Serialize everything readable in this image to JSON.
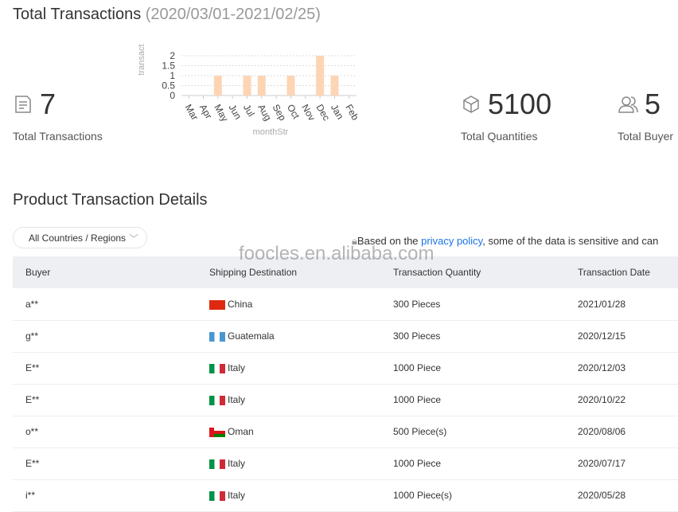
{
  "header": {
    "title": "Total Transactions",
    "date_range": "(2020/03/01-2021/02/25)"
  },
  "stats": [
    {
      "icon": "document-icon",
      "value": "7",
      "label": "Total Transactions"
    },
    {
      "icon": "box-icon",
      "value": "5100",
      "label": "Total Quantities"
    },
    {
      "icon": "users-icon",
      "value": "5",
      "label": "Total Buyer"
    }
  ],
  "chart_data": {
    "type": "bar",
    "categories": [
      "Mar",
      "Apr",
      "May",
      "Jun",
      "Jul",
      "Aug",
      "Sep",
      "Oct",
      "Nov",
      "Dec",
      "Jan",
      "Feb"
    ],
    "values": [
      0,
      0,
      1,
      0,
      1,
      1,
      0,
      1,
      0,
      2,
      1,
      0
    ],
    "xlabel": "monthStr",
    "ylabel": "transact",
    "ylim": [
      0,
      2
    ],
    "yticks": [
      "0",
      "0.5",
      "1",
      "1.5",
      "2"
    ],
    "grid": true,
    "color": "#fdd5b5"
  },
  "section": {
    "title": "Product Transaction Details"
  },
  "filter": {
    "label": "All Countries / Regions"
  },
  "notice": {
    "before": "Based on the ",
    "link": "privacy policy",
    "after": ", some of the data is sensitive and can"
  },
  "watermark": "foocles.en.alibaba.com",
  "table": {
    "columns": [
      "Buyer",
      "Shipping Destination",
      "Transaction Quantity",
      "Transaction Date"
    ],
    "rows": [
      {
        "buyer": "a**",
        "country": "China",
        "flag": "cn",
        "qty": "300 Pieces",
        "date": "2021/01/28"
      },
      {
        "buyer": "g**",
        "country": "Guatemala",
        "flag": "gt",
        "qty": "300 Pieces",
        "date": "2020/12/15"
      },
      {
        "buyer": "E**",
        "country": "Italy",
        "flag": "it",
        "qty": "1000 Piece",
        "date": "2020/12/03"
      },
      {
        "buyer": "E**",
        "country": "Italy",
        "flag": "it",
        "qty": "1000 Piece",
        "date": "2020/10/22"
      },
      {
        "buyer": "o**",
        "country": "Oman",
        "flag": "om",
        "qty": "500 Piece(s)",
        "date": "2020/08/06"
      },
      {
        "buyer": "E**",
        "country": "Italy",
        "flag": "it",
        "qty": "1000 Piece",
        "date": "2020/07/17"
      },
      {
        "buyer": "i**",
        "country": "Italy",
        "flag": "it",
        "qty": "1000 Piece(s)",
        "date": "2020/05/28"
      }
    ]
  }
}
